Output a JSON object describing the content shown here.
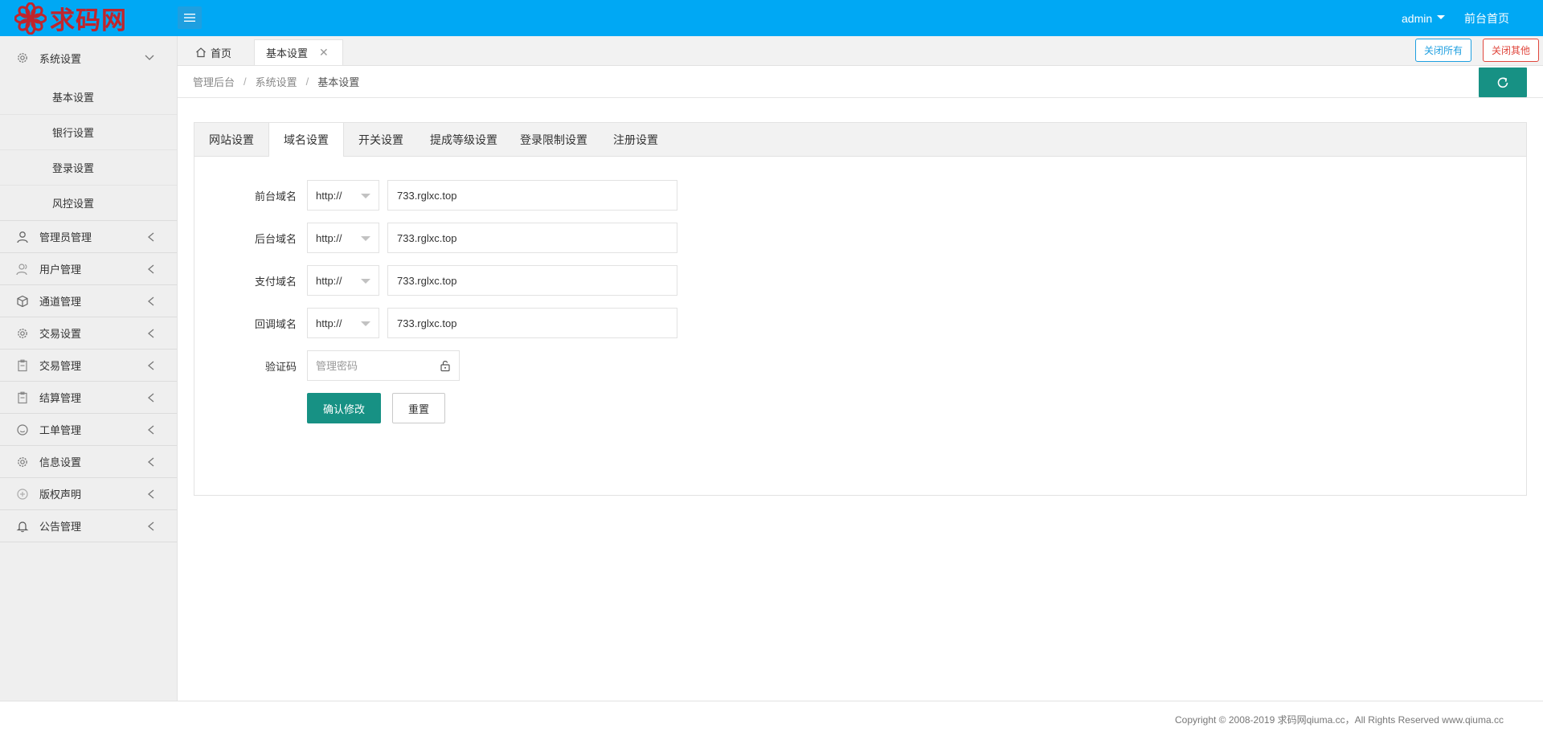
{
  "header": {
    "logo_text": "求码网",
    "admin_label": "admin",
    "front_link": "前台首页"
  },
  "sidebar": {
    "items": [
      {
        "label": "系统设置",
        "icon": "gear-icon",
        "expanded": true,
        "children": [
          "基本设置",
          "银行设置",
          "登录设置",
          "风控设置"
        ]
      },
      {
        "label": "管理员管理",
        "icon": "user-icon"
      },
      {
        "label": "用户管理",
        "icon": "users-icon"
      },
      {
        "label": "通道管理",
        "icon": "cube-icon"
      },
      {
        "label": "交易设置",
        "icon": "gear-icon"
      },
      {
        "label": "交易管理",
        "icon": "clipboard-icon"
      },
      {
        "label": "结算管理",
        "icon": "clipboard-icon"
      },
      {
        "label": "工单管理",
        "icon": "smile-icon"
      },
      {
        "label": "信息设置",
        "icon": "gear-icon"
      },
      {
        "label": "版权声明",
        "icon": "plus-circle-icon"
      },
      {
        "label": "公告管理",
        "icon": "bell-icon"
      }
    ]
  },
  "tabs_bar": {
    "home_tab": "首页",
    "active_tab": "基本设置",
    "close_all": "关闭所有",
    "close_other": "关闭其他"
  },
  "breadcrumb": [
    "管理后台",
    "系统设置",
    "基本设置"
  ],
  "card": {
    "tabs": [
      "网站设置",
      "域名设置",
      "开关设置",
      "提成等级设置",
      "登录限制设置",
      "注册设置"
    ],
    "active_tab_index": 1,
    "fields": [
      {
        "label": "前台域名",
        "protocol": "http://",
        "value": "733.rglxc.top"
      },
      {
        "label": "后台域名",
        "protocol": "http://",
        "value": "733.rglxc.top"
      },
      {
        "label": "支付域名",
        "protocol": "http://",
        "value": "733.rglxc.top"
      },
      {
        "label": "回调域名",
        "protocol": "http://",
        "value": "733.rglxc.top"
      }
    ],
    "captcha": {
      "label": "验证码",
      "placeholder": "管理密码",
      "icon": "lock-icon"
    },
    "submit_label": "确认修改",
    "reset_label": "重置"
  },
  "footer": {
    "copyright": "Copyright © 2008-2019 求码网qiuma.cc，All Rights Reserved www.qiuma.cc"
  },
  "colors": {
    "header_bg": "#00a8f4",
    "primary_green": "#179184",
    "logo_red": "#c0252c",
    "sidebar_bg": "#efefef"
  }
}
